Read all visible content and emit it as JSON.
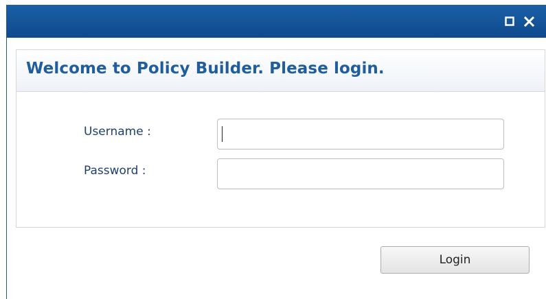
{
  "window": {
    "maximize_icon": "maximize-icon",
    "close_icon": "close-icon",
    "titlebar_color": "#1158a0"
  },
  "login_panel": {
    "title": "Welcome to Policy Builder. Please login.",
    "title_color": "#1f5d9c",
    "username_label": "Username :",
    "username_value": "",
    "password_label": "Password :",
    "password_value": ""
  },
  "actions": {
    "login_label": "Login"
  }
}
